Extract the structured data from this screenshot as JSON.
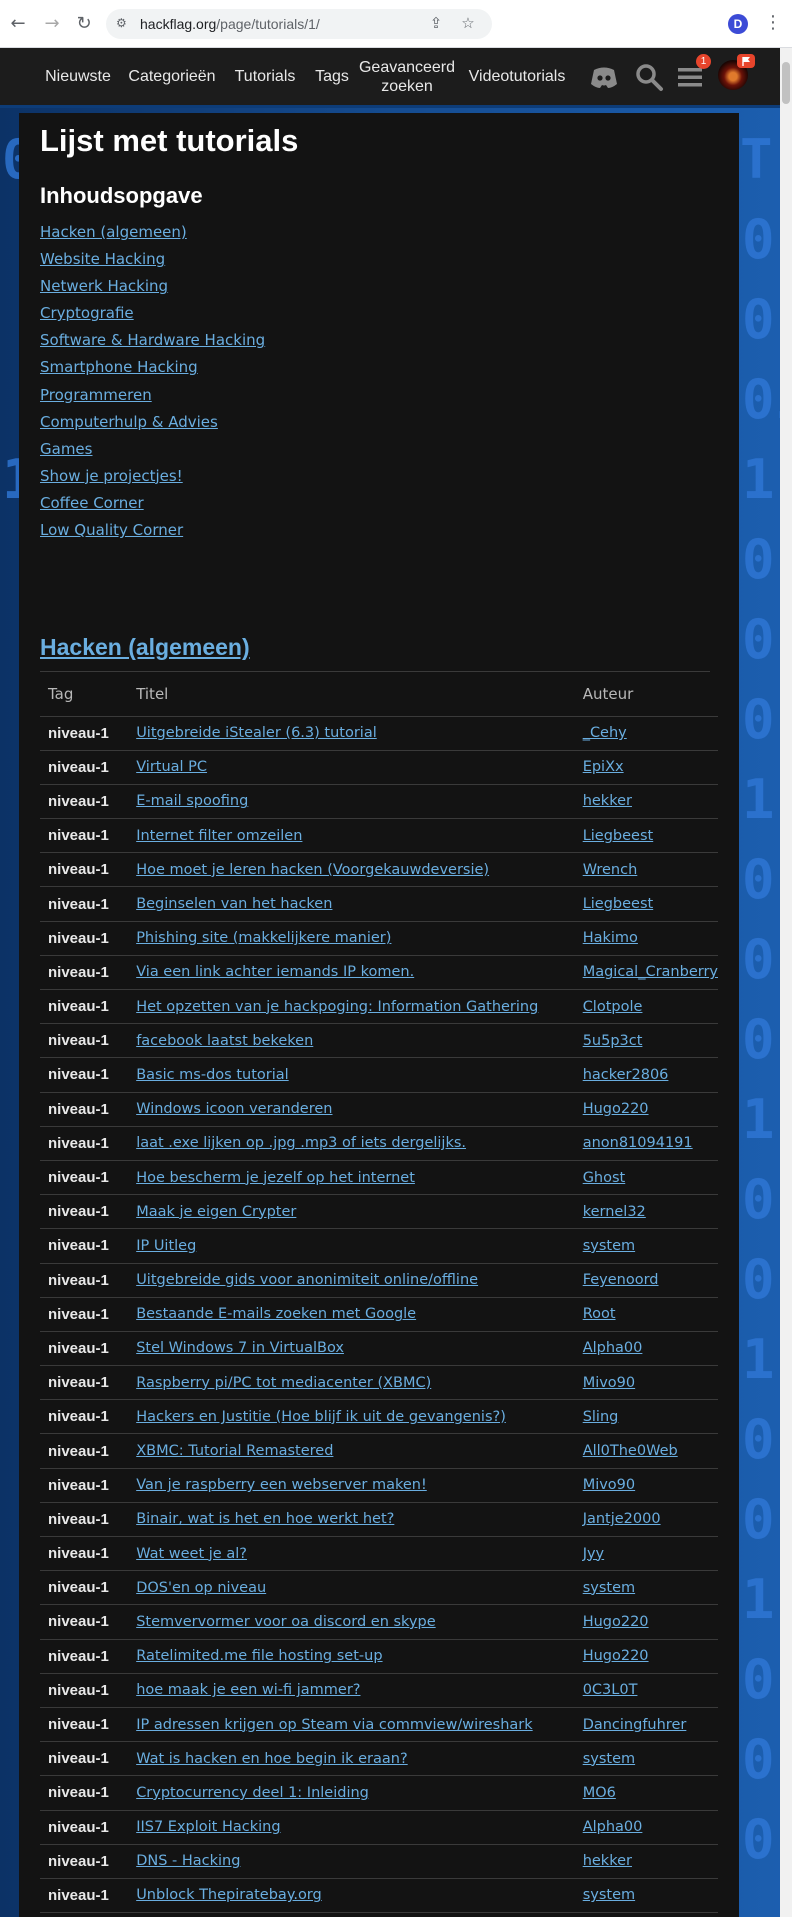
{
  "browser": {
    "url_host": "hackflag.org",
    "url_path": "/page/tutorials/1/",
    "profile_initial": "D"
  },
  "nav": {
    "links": [
      "Nieuwste",
      "Categorieën",
      "Tutorials",
      "Tags",
      "Geavanceerd zoeken",
      "Videotutorials"
    ],
    "menu_badge": "1"
  },
  "page": {
    "title": "Lijst met tutorials",
    "toc_title": "Inhoudsopgave",
    "toc": [
      "Hacken (algemeen)",
      "Website Hacking",
      "Netwerk Hacking",
      "Cryptografie",
      "Software & Hardware Hacking",
      "Smartphone Hacking",
      "Programmeren",
      "Computerhulp & Advies",
      "Games",
      "Show je projectjes!",
      "Coffee Corner",
      "Low Quality Corner"
    ],
    "section_title": "Hacken (algemeen)"
  },
  "table": {
    "headers": [
      "Tag",
      "Titel",
      "Auteur"
    ],
    "rows": [
      {
        "tag": "niveau-1",
        "title": "Uitgebreide iStealer (6.3) tutorial",
        "author": "_Cehy"
      },
      {
        "tag": "niveau-1",
        "title": "Virtual PC",
        "author": "EpiXx"
      },
      {
        "tag": "niveau-1",
        "title": "E-mail spoofing",
        "author": "hekker"
      },
      {
        "tag": "niveau-1",
        "title": "Internet filter omzeilen",
        "author": "Liegbeest"
      },
      {
        "tag": "niveau-1",
        "title": "Hoe moet je leren hacken (Voorgekauwdeversie)",
        "author": "Wrench"
      },
      {
        "tag": "niveau-1",
        "title": "Beginselen van het hacken",
        "author": "Liegbeest"
      },
      {
        "tag": "niveau-1",
        "title": "Phishing site (makkelijkere manier)",
        "author": "Hakimo"
      },
      {
        "tag": "niveau-1",
        "title": "Via een link achter iemands IP komen.",
        "author": "Magical_Cranberry"
      },
      {
        "tag": "niveau-1",
        "title": "Het opzetten van je hackpoging: Information Gathering",
        "author": "Clotpole"
      },
      {
        "tag": "niveau-1",
        "title": "facebook laatst bekeken",
        "author": "5u5p3ct"
      },
      {
        "tag": "niveau-1",
        "title": "Basic ms-dos tutorial",
        "author": "hacker2806"
      },
      {
        "tag": "niveau-1",
        "title": "Windows icoon veranderen",
        "author": "Hugo220"
      },
      {
        "tag": "niveau-1",
        "title": "laat .exe lijken op .jpg .mp3 of iets dergelijks.",
        "author": "anon81094191"
      },
      {
        "tag": "niveau-1",
        "title": "Hoe bescherm je jezelf op het internet",
        "author": "Ghost"
      },
      {
        "tag": "niveau-1",
        "title": "Maak je eigen Crypter",
        "author": "kernel32"
      },
      {
        "tag": "niveau-1",
        "title": "IP Uitleg",
        "author": "system"
      },
      {
        "tag": "niveau-1",
        "title": "Uitgebreide gids voor anonimiteit online/offline",
        "author": "Feyenoord"
      },
      {
        "tag": "niveau-1",
        "title": "Bestaande E-mails zoeken met Google",
        "author": "Root"
      },
      {
        "tag": "niveau-1",
        "title": "Stel Windows 7 in VirtualBox",
        "author": "Alpha00"
      },
      {
        "tag": "niveau-1",
        "title": "Raspberry pi/PC tot mediacenter (XBMC)",
        "author": "Mivo90"
      },
      {
        "tag": "niveau-1",
        "title": "Hackers en Justitie (Hoe blijf ik uit de gevangenis?)",
        "author": "Sling"
      },
      {
        "tag": "niveau-1",
        "title": "XBMC: Tutorial Remastered",
        "author": "All0The0Web"
      },
      {
        "tag": "niveau-1",
        "title": "Van je raspberry een webserver maken!",
        "author": "Mivo90"
      },
      {
        "tag": "niveau-1",
        "title": "Binair, wat is het en hoe werkt het?",
        "author": "Jantje2000"
      },
      {
        "tag": "niveau-1",
        "title": "Wat weet je al?",
        "author": "Jyy"
      },
      {
        "tag": "niveau-1",
        "title": "DOS'en op niveau",
        "author": "system"
      },
      {
        "tag": "niveau-1",
        "title": "Stemvervormer voor oa discord en skype",
        "author": "Hugo220"
      },
      {
        "tag": "niveau-1",
        "title": "Ratelimited.me file hosting set-up",
        "author": "Hugo220"
      },
      {
        "tag": "niveau-1",
        "title": "hoe maak je een wi-fi jammer?",
        "author": "0C3L0T"
      },
      {
        "tag": "niveau-1",
        "title": "IP adressen krijgen op Steam via commview/wireshark",
        "author": "Dancingfuhrer"
      },
      {
        "tag": "niveau-1",
        "title": "Wat is hacken en hoe begin ik eraan?",
        "author": "system"
      },
      {
        "tag": "niveau-1",
        "title": "Cryptocurrency deel 1: Inleiding",
        "author": "MO6"
      },
      {
        "tag": "niveau-1",
        "title": "IIS7 Exploit Hacking",
        "author": "Alpha00"
      },
      {
        "tag": "niveau-1",
        "title": "DNS - Hacking",
        "author": "hekker"
      },
      {
        "tag": "niveau-1",
        "title": "Unblock Thepiratebay.org",
        "author": "system"
      }
    ]
  }
}
